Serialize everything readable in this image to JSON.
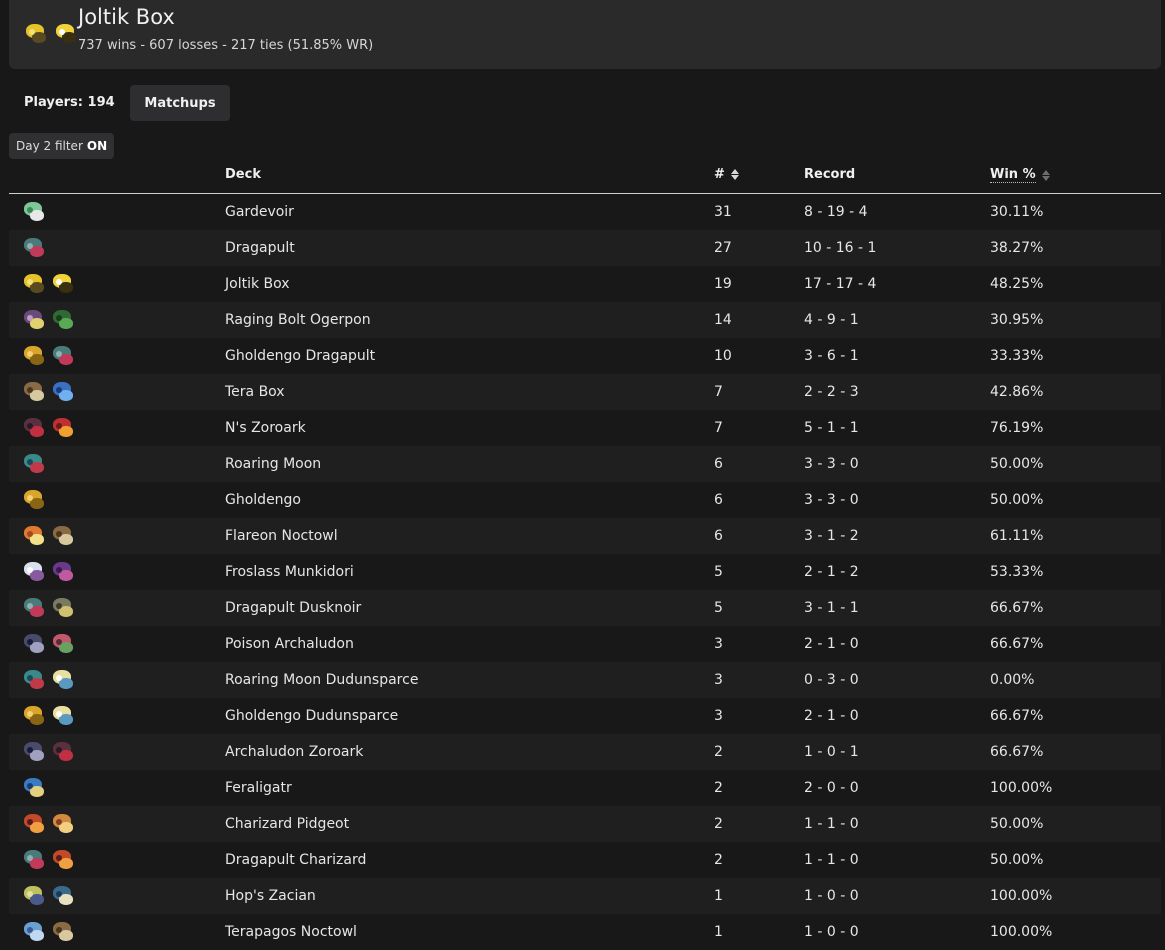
{
  "header": {
    "title": "Joltik Box",
    "subtitle": "737 wins - 607 losses - 217 ties (51.85% WR)",
    "icons": [
      {
        "name": "joltik",
        "colors": [
          "#e6c22a",
          "#5a4a20",
          "#f2e27a"
        ]
      },
      {
        "name": "pikachu",
        "colors": [
          "#f0d23a",
          "#3a2f10",
          "#ffffff"
        ]
      }
    ]
  },
  "players_label": "Players: 194",
  "matchups_label": "Matchups",
  "filter": {
    "text": "Day 2 filter",
    "state": "ON"
  },
  "columns": {
    "deck": "Deck",
    "count": "#",
    "record": "Record",
    "win": "Win %"
  },
  "rows": [
    {
      "deck": "Gardevoir",
      "count": "31",
      "record": "8 - 19 - 4",
      "win": "30.11%",
      "icons": [
        {
          "name": "gardevoir",
          "colors": [
            "#7fc79a",
            "#e8e8e8",
            "#3a8a55"
          ]
        }
      ]
    },
    {
      "deck": "Dragapult",
      "count": "27",
      "record": "10 - 16 - 1",
      "win": "38.27%",
      "icons": [
        {
          "name": "dragapult",
          "colors": [
            "#4a7a7a",
            "#c23a5a",
            "#8fb0b0"
          ]
        }
      ]
    },
    {
      "deck": "Joltik Box",
      "count": "19",
      "record": "17 - 17 - 4",
      "win": "48.25%",
      "icons": [
        {
          "name": "joltik",
          "colors": [
            "#e6c22a",
            "#5a4a20",
            "#f2e27a"
          ]
        },
        {
          "name": "pikachu",
          "colors": [
            "#f0d23a",
            "#3a2f10",
            "#ffffff"
          ]
        }
      ]
    },
    {
      "deck": "Raging Bolt Ogerpon",
      "count": "14",
      "record": "4 - 9 - 1",
      "win": "30.95%",
      "icons": [
        {
          "name": "raging-bolt",
          "colors": [
            "#6a4a7a",
            "#e0d070",
            "#c0a0c0"
          ]
        },
        {
          "name": "ogerpon",
          "colors": [
            "#2f6a35",
            "#5aaa55",
            "#1a3a20"
          ]
        }
      ]
    },
    {
      "deck": "Gholdengo Dragapult",
      "count": "10",
      "record": "3 - 6 - 1",
      "win": "33.33%",
      "icons": [
        {
          "name": "gholdengo",
          "colors": [
            "#d9a52a",
            "#8a6515",
            "#f3d070"
          ]
        },
        {
          "name": "dragapult",
          "colors": [
            "#4a7a7a",
            "#c23a5a",
            "#8fb0b0"
          ]
        }
      ]
    },
    {
      "deck": "Tera Box",
      "count": "7",
      "record": "2 - 2 - 3",
      "win": "42.86%",
      "icons": [
        {
          "name": "noctowl",
          "colors": [
            "#8a6a45",
            "#d8c8a0",
            "#4a3520"
          ]
        },
        {
          "name": "tera-orb",
          "colors": [
            "#3a70c0",
            "#70b0f0",
            "#1a3a80"
          ]
        }
      ]
    },
    {
      "deck": "N's Zoroark",
      "count": "7",
      "record": "5 - 1 - 1",
      "win": "76.19%",
      "icons": [
        {
          "name": "zoroark",
          "colors": [
            "#5a3040",
            "#c03040",
            "#2a1a25"
          ]
        },
        {
          "name": "darmanitan",
          "colors": [
            "#c03030",
            "#f0a030",
            "#6a1a1a"
          ]
        }
      ]
    },
    {
      "deck": "Roaring Moon",
      "count": "6",
      "record": "3 - 3 - 0",
      "win": "50.00%",
      "icons": [
        {
          "name": "roaring-moon",
          "colors": [
            "#3a8a8a",
            "#c03a4a",
            "#1a4a5a"
          ]
        }
      ]
    },
    {
      "deck": "Gholdengo",
      "count": "6",
      "record": "3 - 3 - 0",
      "win": "50.00%",
      "icons": [
        {
          "name": "gholdengo",
          "colors": [
            "#d9a52a",
            "#8a6515",
            "#f3d070"
          ]
        }
      ]
    },
    {
      "deck": "Flareon Noctowl",
      "count": "6",
      "record": "3 - 1 - 2",
      "win": "61.11%",
      "icons": [
        {
          "name": "flareon",
          "colors": [
            "#e07a30",
            "#f3e08a",
            "#a04a20"
          ]
        },
        {
          "name": "noctowl",
          "colors": [
            "#8a6a45",
            "#d8c8a0",
            "#4a3520"
          ]
        }
      ]
    },
    {
      "deck": "Froslass Munkidori",
      "count": "5",
      "record": "2 - 1 - 2",
      "win": "53.33%",
      "icons": [
        {
          "name": "froslass",
          "colors": [
            "#d8e0f0",
            "#8a5aa0",
            "#ffffff"
          ]
        },
        {
          "name": "munkidori",
          "colors": [
            "#6a3a8a",
            "#c05aa0",
            "#3a1a4a"
          ]
        }
      ]
    },
    {
      "deck": "Dragapult Dusknoir",
      "count": "5",
      "record": "3 - 1 - 1",
      "win": "66.67%",
      "icons": [
        {
          "name": "dragapult",
          "colors": [
            "#4a7a7a",
            "#c23a5a",
            "#8fb0b0"
          ]
        },
        {
          "name": "dusknoir",
          "colors": [
            "#7a7a60",
            "#d0c070",
            "#3a3a2a"
          ]
        }
      ]
    },
    {
      "deck": "Poison Archaludon",
      "count": "3",
      "record": "2 - 1 - 0",
      "win": "66.67%",
      "icons": [
        {
          "name": "archaludon",
          "colors": [
            "#4a4a6a",
            "#a0a0c0",
            "#1a1a3a"
          ]
        },
        {
          "name": "pecharunt",
          "colors": [
            "#c05a6a",
            "#6aa060",
            "#5a2a3a"
          ]
        }
      ]
    },
    {
      "deck": "Roaring Moon Dudunsparce",
      "count": "3",
      "record": "0 - 3 - 0",
      "win": "0.00%",
      "icons": [
        {
          "name": "roaring-moon",
          "colors": [
            "#3a8a8a",
            "#c03a4a",
            "#1a4a5a"
          ]
        },
        {
          "name": "dudunsparce",
          "colors": [
            "#e8e0a0",
            "#5a9ac0",
            "#ffffff"
          ]
        }
      ]
    },
    {
      "deck": "Gholdengo Dudunsparce",
      "count": "3",
      "record": "2 - 1 - 0",
      "win": "66.67%",
      "icons": [
        {
          "name": "gholdengo",
          "colors": [
            "#d9a52a",
            "#8a6515",
            "#f3d070"
          ]
        },
        {
          "name": "dudunsparce",
          "colors": [
            "#e8e0a0",
            "#5a9ac0",
            "#ffffff"
          ]
        }
      ]
    },
    {
      "deck": "Archaludon Zoroark",
      "count": "2",
      "record": "1 - 0 - 1",
      "win": "66.67%",
      "icons": [
        {
          "name": "archaludon",
          "colors": [
            "#4a4a6a",
            "#a0a0c0",
            "#1a1a3a"
          ]
        },
        {
          "name": "zoroark",
          "colors": [
            "#5a3040",
            "#c03040",
            "#2a1a25"
          ]
        }
      ]
    },
    {
      "deck": "Feraligatr",
      "count": "2",
      "record": "2 - 0 - 0",
      "win": "100.00%",
      "icons": [
        {
          "name": "feraligatr",
          "colors": [
            "#3a7ac0",
            "#e0d080",
            "#1a3a70"
          ]
        }
      ]
    },
    {
      "deck": "Charizard Pidgeot",
      "count": "2",
      "record": "1 - 1 - 0",
      "win": "50.00%",
      "icons": [
        {
          "name": "charizard",
          "colors": [
            "#c04a2a",
            "#f0a040",
            "#5a1a1a"
          ]
        },
        {
          "name": "pidgeot",
          "colors": [
            "#d08a40",
            "#f0d080",
            "#8a3a20"
          ]
        }
      ]
    },
    {
      "deck": "Dragapult Charizard",
      "count": "2",
      "record": "1 - 1 - 0",
      "win": "50.00%",
      "icons": [
        {
          "name": "dragapult",
          "colors": [
            "#4a7a7a",
            "#c23a5a",
            "#8fb0b0"
          ]
        },
        {
          "name": "charizard",
          "colors": [
            "#c04a2a",
            "#f0a040",
            "#5a1a1a"
          ]
        }
      ]
    },
    {
      "deck": "Hop's Zacian",
      "count": "1",
      "record": "1 - 0 - 0",
      "win": "100.00%",
      "icons": [
        {
          "name": "zacian",
          "colors": [
            "#c0c060",
            "#4a5a8a",
            "#e0e0a0"
          ]
        },
        {
          "name": "snorlax",
          "colors": [
            "#3a6a8a",
            "#e8e0c0",
            "#1a3a5a"
          ]
        }
      ]
    },
    {
      "deck": "Terapagos Noctowl",
      "count": "1",
      "record": "1 - 0 - 0",
      "win": "100.00%",
      "icons": [
        {
          "name": "terapagos",
          "colors": [
            "#6aa0d0",
            "#c0d8f0",
            "#3a5a9a"
          ]
        },
        {
          "name": "noctowl",
          "colors": [
            "#8a6a45",
            "#d8c8a0",
            "#4a3520"
          ]
        }
      ]
    }
  ]
}
